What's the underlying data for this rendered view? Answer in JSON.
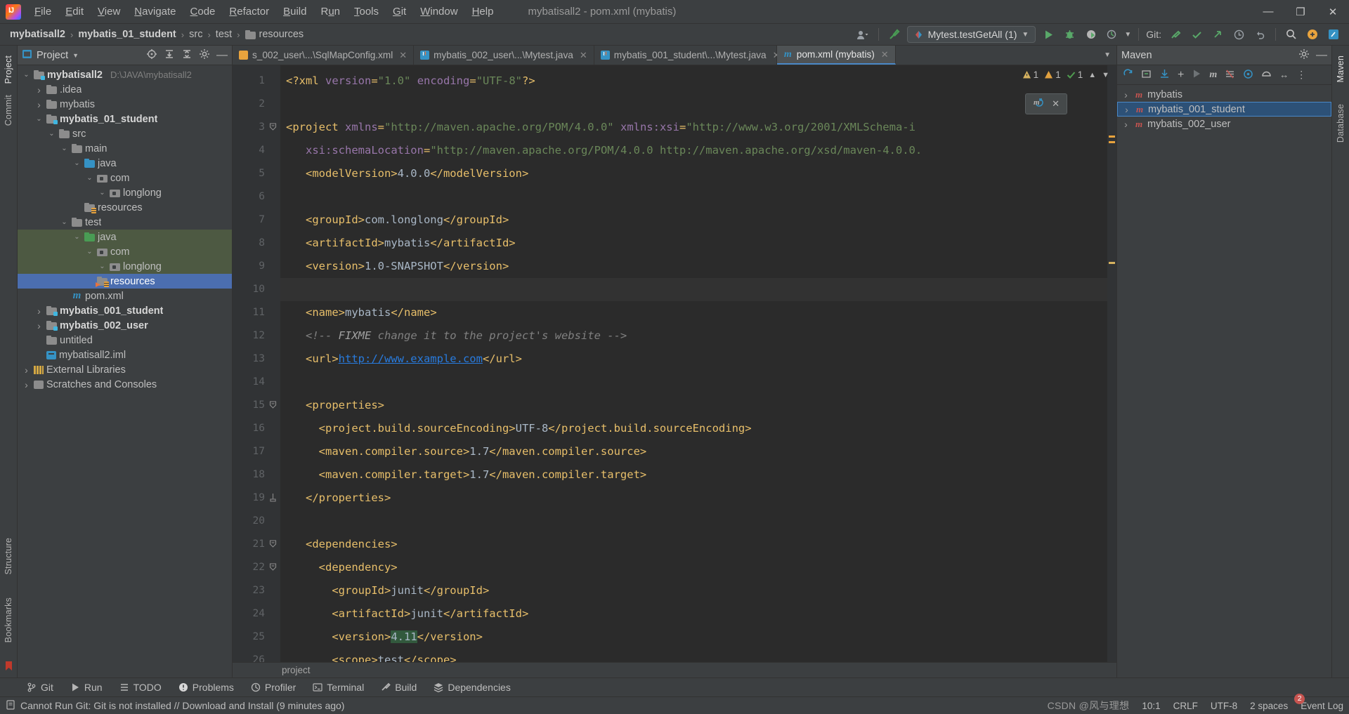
{
  "window": {
    "title": "mybatisall2 - pom.xml (mybatis)",
    "minimize": "—",
    "maximize": "❐",
    "close": "✕"
  },
  "menu": [
    {
      "label": "File"
    },
    {
      "label": "Edit"
    },
    {
      "label": "View"
    },
    {
      "label": "Navigate"
    },
    {
      "label": "Code"
    },
    {
      "label": "Refactor"
    },
    {
      "label": "Build"
    },
    {
      "label": "Run"
    },
    {
      "label": "Tools"
    },
    {
      "label": "Git"
    },
    {
      "label": "Window"
    },
    {
      "label": "Help"
    }
  ],
  "breadcrumb": {
    "items": [
      {
        "label": "mybatisall2",
        "bold": true
      },
      {
        "label": "mybatis_01_student",
        "bold": true
      },
      {
        "label": "src",
        "bold": false
      },
      {
        "label": "test",
        "bold": false
      },
      {
        "label": "resources",
        "bold": false,
        "icon": "folder-icon"
      }
    ],
    "separator": "›"
  },
  "toolbar": {
    "account_icon": "user-icon",
    "build_icon": "hammer-icon",
    "run_config": "Mytest.testGetAll (1)",
    "run_icon": "run-icon",
    "debug_icon": "debug-icon",
    "run_coverage_icon": "run-with-coverage-icon",
    "profiler_icon": "profiler-icon",
    "git_label": "Git:",
    "git_update_icon": "update-project-icon",
    "git_commit_icon": "commit-icon",
    "git_push_icon": "push-icon",
    "history_icon": "history-icon",
    "undo_icon": "undo-icon",
    "search_icon": "search-icon",
    "plugin_icon": "plugins-icon",
    "ide_icon": "ide-icon"
  },
  "left_rail": {
    "tabs": [
      {
        "label": "Project",
        "active": true
      },
      {
        "label": "Commit",
        "active": false
      },
      {
        "label": "Structure",
        "active": false
      },
      {
        "label": "Bookmarks",
        "active": false
      }
    ]
  },
  "project_panel": {
    "title": "Project",
    "dropdown_icon": "chevron-down-icon",
    "actions": [
      "locate-icon",
      "expand-all-icon",
      "collapse-all-icon",
      "settings-icon",
      "hide-icon"
    ],
    "tree": [
      {
        "depth": 0,
        "label": "mybatisall2",
        "path": "D:\\JAVA\\mybatisall2",
        "arrow": "expanded",
        "icon": "module-folder-icon",
        "bold": true
      },
      {
        "depth": 1,
        "label": ".idea",
        "arrow": "collapsed",
        "icon": "folder-icon"
      },
      {
        "depth": 1,
        "label": "mybatis",
        "arrow": "collapsed",
        "icon": "folder-icon"
      },
      {
        "depth": 1,
        "label": "mybatis_01_student",
        "arrow": "expanded",
        "icon": "module-folder-icon",
        "bold": true
      },
      {
        "depth": 2,
        "label": "src",
        "arrow": "expanded",
        "icon": "folder-icon"
      },
      {
        "depth": 3,
        "label": "main",
        "arrow": "expanded",
        "icon": "folder-icon"
      },
      {
        "depth": 4,
        "label": "java",
        "arrow": "expanded",
        "icon": "source-root-icon"
      },
      {
        "depth": 5,
        "label": "com",
        "arrow": "expanded",
        "icon": "package-icon"
      },
      {
        "depth": 6,
        "label": "longlong",
        "arrow": "expanded",
        "icon": "package-icon"
      },
      {
        "depth": 4,
        "label": "resources",
        "arrow": "none",
        "icon": "resource-root-icon"
      },
      {
        "depth": 3,
        "label": "test",
        "arrow": "expanded",
        "icon": "folder-icon"
      },
      {
        "depth": 4,
        "label": "java",
        "arrow": "expanded",
        "icon": "test-source-root-icon",
        "srcroot": true
      },
      {
        "depth": 5,
        "label": "com",
        "arrow": "expanded",
        "icon": "package-icon",
        "srcroot": true
      },
      {
        "depth": 6,
        "label": "longlong",
        "arrow": "expanded",
        "icon": "package-icon",
        "srcroot": true
      },
      {
        "depth": 5,
        "label": "resources",
        "arrow": "none",
        "icon": "test-resource-root-icon",
        "selected": true
      },
      {
        "depth": 3,
        "label": "pom.xml",
        "arrow": "none",
        "icon": "maven-file-icon"
      },
      {
        "depth": 1,
        "label": "mybatis_001_student",
        "arrow": "collapsed",
        "icon": "module-folder-icon",
        "bold": true
      },
      {
        "depth": 1,
        "label": "mybatis_002_user",
        "arrow": "collapsed",
        "icon": "module-folder-icon",
        "bold": true
      },
      {
        "depth": 1,
        "label": "untitled",
        "arrow": "none",
        "icon": "folder-icon"
      },
      {
        "depth": 1,
        "label": "mybatisall2.iml",
        "arrow": "none",
        "icon": "iml-file-icon"
      },
      {
        "depth": 0,
        "label": "External Libraries",
        "arrow": "collapsed",
        "icon": "library-icon"
      },
      {
        "depth": 0,
        "label": "Scratches and Consoles",
        "arrow": "collapsed",
        "icon": "scratches-icon"
      }
    ]
  },
  "editor": {
    "tabs": [
      {
        "label": "s_002_user\\...\\SqlMapConfig.xml",
        "icon": "xml-file-icon",
        "active": false,
        "close": "✕"
      },
      {
        "label": "mybatis_002_user\\...\\Mytest.java",
        "icon": "java-file-icon",
        "active": false,
        "close": "✕"
      },
      {
        "label": "mybatis_001_student\\...\\Mytest.java",
        "icon": "java-file-icon",
        "active": false,
        "close": "✕"
      },
      {
        "label": "pom.xml (mybatis)",
        "icon": "maven-file-icon",
        "active": true,
        "close": "✕"
      }
    ],
    "tab_list_icon": "chevron-down-icon",
    "inspections": {
      "warnings": "1",
      "weak_warnings": "1",
      "typos": "1",
      "up_icon": "chevron-up-icon",
      "down_icon": "chevron-down-icon"
    },
    "breadcrumb_bottom": "project",
    "popup": {
      "maven_icon": "maven-reload-icon",
      "close_icon": "close-icon"
    },
    "lines": [
      {
        "n": 1,
        "fold": false,
        "segments": [
          {
            "t": "tag",
            "s": "<?xml "
          },
          {
            "t": "attr",
            "s": "version"
          },
          {
            "t": "tag",
            "s": "="
          },
          {
            "t": "str",
            "s": "\"1.0\""
          },
          {
            "t": "tag",
            "s": " "
          },
          {
            "t": "attr",
            "s": "encoding"
          },
          {
            "t": "tag",
            "s": "="
          },
          {
            "t": "str",
            "s": "\"UTF-8\""
          },
          {
            "t": "tag",
            "s": "?>"
          }
        ]
      },
      {
        "n": 2,
        "fold": false,
        "segments": []
      },
      {
        "n": 3,
        "fold": true,
        "segments": [
          {
            "t": "tag",
            "s": "<project "
          },
          {
            "t": "attr",
            "s": "xmlns"
          },
          {
            "t": "tag",
            "s": "="
          },
          {
            "t": "str",
            "s": "\"http://maven.apache.org/POM/4.0.0\""
          },
          {
            "t": "tag",
            "s": " "
          },
          {
            "t": "attr",
            "s": "xmlns:xsi"
          },
          {
            "t": "tag",
            "s": "="
          },
          {
            "t": "str",
            "s": "\"http://www.w3.org/2001/XMLSchema-i"
          }
        ]
      },
      {
        "n": 4,
        "fold": false,
        "segments": [
          {
            "t": "txt",
            "s": "   "
          },
          {
            "t": "attr",
            "s": "xsi:schemaLocation"
          },
          {
            "t": "tag",
            "s": "="
          },
          {
            "t": "str",
            "s": "\"http://maven.apache.org/POM/4.0.0 http://maven.apache.org/xsd/maven-4.0.0."
          }
        ]
      },
      {
        "n": 5,
        "fold": false,
        "segments": [
          {
            "t": "tag",
            "s": "   <modelVersion>"
          },
          {
            "t": "txt",
            "s": "4.0.0"
          },
          {
            "t": "tag",
            "s": "</modelVersion>"
          }
        ]
      },
      {
        "n": 6,
        "fold": false,
        "segments": []
      },
      {
        "n": 7,
        "fold": false,
        "segments": [
          {
            "t": "tag",
            "s": "   <groupId>"
          },
          {
            "t": "txt",
            "s": "com.longlong"
          },
          {
            "t": "tag",
            "s": "</groupId>"
          }
        ]
      },
      {
        "n": 8,
        "fold": false,
        "segments": [
          {
            "t": "tag",
            "s": "   <artifactId>"
          },
          {
            "t": "txt",
            "s": "mybatis"
          },
          {
            "t": "tag",
            "s": "</artifactId>"
          }
        ]
      },
      {
        "n": 9,
        "fold": false,
        "segments": [
          {
            "t": "tag",
            "s": "   <version>"
          },
          {
            "t": "txt",
            "s": "1.0-SNAPSHOT"
          },
          {
            "t": "tag",
            "s": "</version>"
          }
        ]
      },
      {
        "n": 10,
        "fold": false,
        "current": true,
        "segments": []
      },
      {
        "n": 11,
        "fold": false,
        "segments": [
          {
            "t": "tag",
            "s": "   <name>"
          },
          {
            "t": "txt",
            "s": "mybatis"
          },
          {
            "t": "tag",
            "s": "</name>"
          }
        ]
      },
      {
        "n": 12,
        "fold": false,
        "segments": [
          {
            "t": "cmt",
            "s": "   <!-- "
          },
          {
            "t": "cmtb",
            "s": "FIXME"
          },
          {
            "t": "cmt",
            "s": " change it to the project's website -->"
          }
        ]
      },
      {
        "n": 13,
        "fold": false,
        "segments": [
          {
            "t": "tag",
            "s": "   <url>"
          },
          {
            "t": "lnk",
            "s": "http://www.example.com"
          },
          {
            "t": "tag",
            "s": "</url>"
          }
        ]
      },
      {
        "n": 14,
        "fold": false,
        "segments": []
      },
      {
        "n": 15,
        "fold": true,
        "segments": [
          {
            "t": "tag",
            "s": "   <properties>"
          }
        ]
      },
      {
        "n": 16,
        "fold": false,
        "segments": [
          {
            "t": "tag",
            "s": "     <project.build.sourceEncoding>"
          },
          {
            "t": "txt",
            "s": "UTF-8"
          },
          {
            "t": "tag",
            "s": "</project.build.sourceEncoding>"
          }
        ]
      },
      {
        "n": 17,
        "fold": false,
        "segments": [
          {
            "t": "tag",
            "s": "     <maven.compiler.source>"
          },
          {
            "t": "txt",
            "s": "1.7"
          },
          {
            "t": "tag",
            "s": "</maven.compiler.source>"
          }
        ]
      },
      {
        "n": 18,
        "fold": false,
        "segments": [
          {
            "t": "tag",
            "s": "     <maven.compiler.target>"
          },
          {
            "t": "txt",
            "s": "1.7"
          },
          {
            "t": "tag",
            "s": "</maven.compiler.target>"
          }
        ]
      },
      {
        "n": 19,
        "fold": "end",
        "segments": [
          {
            "t": "tag",
            "s": "   </properties>"
          }
        ]
      },
      {
        "n": 20,
        "fold": false,
        "segments": []
      },
      {
        "n": 21,
        "fold": true,
        "segments": [
          {
            "t": "tag",
            "s": "   <dependencies>"
          }
        ]
      },
      {
        "n": 22,
        "fold": true,
        "segments": [
          {
            "t": "tag",
            "s": "     <dependency>"
          }
        ]
      },
      {
        "n": 23,
        "fold": false,
        "segments": [
          {
            "t": "tag",
            "s": "       <groupId>"
          },
          {
            "t": "txt",
            "s": "junit"
          },
          {
            "t": "tag",
            "s": "</groupId>"
          }
        ]
      },
      {
        "n": 24,
        "fold": false,
        "segments": [
          {
            "t": "tag",
            "s": "       <artifactId>"
          },
          {
            "t": "txt",
            "s": "junit"
          },
          {
            "t": "tag",
            "s": "</artifactId>"
          }
        ]
      },
      {
        "n": 25,
        "fold": false,
        "segments": [
          {
            "t": "tag",
            "s": "       <version>"
          },
          {
            "t": "hl",
            "s": "4.11"
          },
          {
            "t": "tag",
            "s": "</version>"
          }
        ]
      },
      {
        "n": 26,
        "fold": false,
        "segments": [
          {
            "t": "tag",
            "s": "       <scope>"
          },
          {
            "t": "txt",
            "s": "test"
          },
          {
            "t": "tag",
            "s": "</scope>"
          }
        ]
      }
    ]
  },
  "maven_panel": {
    "title": "Maven",
    "settings_icon": "gear-icon",
    "hide_icon": "hide-icon",
    "toolbar_icons": [
      "reload-icon",
      "generate-sources-icon",
      "download-sources-icon",
      "add-icon",
      "run-maven-build-icon",
      "maven-m-icon",
      "toggle-skip-tests-icon",
      "execute-goal-icon",
      "toggle-offline-icon",
      "expand-icon",
      "more-icon"
    ],
    "items": [
      {
        "label": "mybatis",
        "arrow": "collapsed",
        "selected": false
      },
      {
        "label": "mybatis_001_student",
        "arrow": "collapsed",
        "selected": true
      },
      {
        "label": "mybatis_002_user",
        "arrow": "collapsed",
        "selected": false
      }
    ]
  },
  "right_rail": {
    "tabs": [
      {
        "label": "Maven",
        "active": true
      },
      {
        "label": "Database",
        "active": false
      }
    ]
  },
  "toolwindow_bar": {
    "items": [
      {
        "label": "Git",
        "icon": "git-branch-icon"
      },
      {
        "label": "Run",
        "icon": "run-icon"
      },
      {
        "label": "TODO",
        "icon": "todo-icon"
      },
      {
        "label": "Problems",
        "icon": "problems-icon"
      },
      {
        "label": "Profiler",
        "icon": "profiler-icon"
      },
      {
        "label": "Terminal",
        "icon": "terminal-icon"
      },
      {
        "label": "Build",
        "icon": "build-icon"
      },
      {
        "label": "Dependencies",
        "icon": "dependencies-icon"
      }
    ]
  },
  "statusbar": {
    "message_icon": "notification-icon",
    "message": "Cannot Run Git: Git is not installed // Download and Install (9 minutes ago)",
    "caret": "10:1",
    "line_separator": "CRLF",
    "encoding": "UTF-8",
    "indent": "2 spaces",
    "watermark": "CSDN @风与理想",
    "event_log": "Event Log",
    "event_count": "2"
  },
  "colors": {
    "accent": "#4b6eaf",
    "tag": "#e8bf6a",
    "string": "#6a8759",
    "attribute": "#9876aa",
    "background": "#2b2b2b",
    "panel": "#3c3f41"
  }
}
